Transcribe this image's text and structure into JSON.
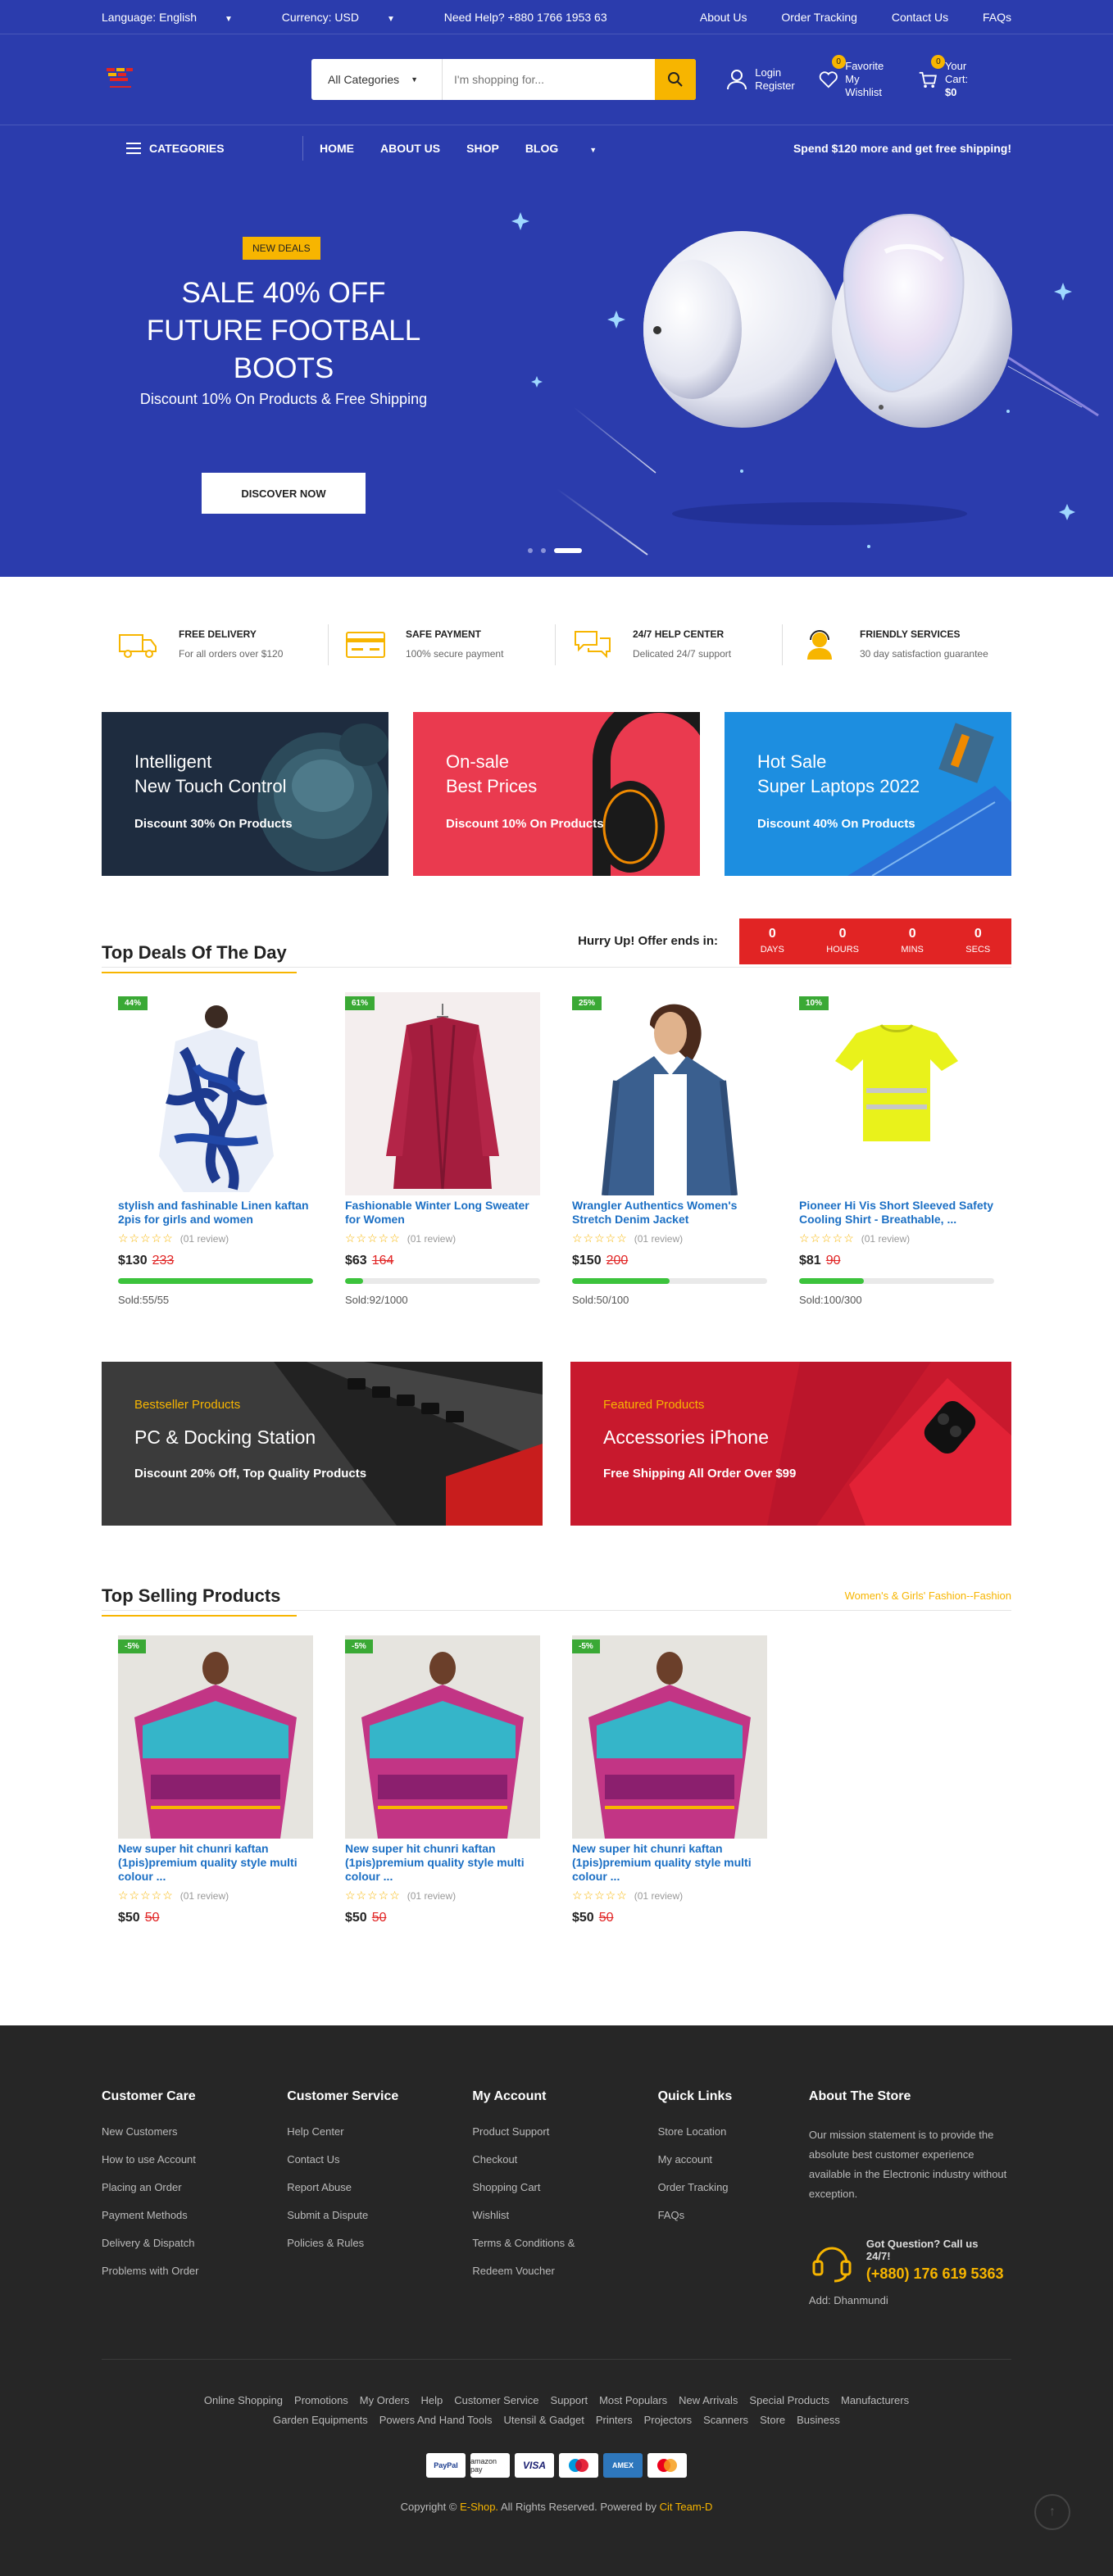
{
  "topbar": {
    "language": "Language: English",
    "currency": "Currency: USD",
    "help": "Need Help? +880 1766 1953 63",
    "links": [
      "About Us",
      "Order Tracking",
      "Contact Us",
      "FAQs"
    ]
  },
  "header": {
    "search_category": "All Categories",
    "search_placeholder": "I'm shopping for...",
    "login": "Login",
    "register": "Register",
    "favorite": "Favorite",
    "wishlist": "My Wishlist",
    "wishlist_count": "0",
    "cart_label": "Your Cart:",
    "cart_total": "$0",
    "cart_count": "0"
  },
  "nav": {
    "categories": "CATEGORIES",
    "links": [
      "HOME",
      "ABOUT US",
      "SHOP",
      "BLOG"
    ],
    "promo": "Spend $120 more and get free shipping!"
  },
  "hero": {
    "tag": "NEW DEALS",
    "title_1": "SALE 40% OFF",
    "title_2": "FUTURE FOOTBALL",
    "title_3": "BOOTS",
    "subtitle": "Discount 10% On Products & Free Shipping",
    "cta": "DISCOVER NOW"
  },
  "features": [
    {
      "title": "FREE DELIVERY",
      "sub": "For all orders over $120"
    },
    {
      "title": "SAFE PAYMENT",
      "sub": "100% secure payment"
    },
    {
      "title": "24/7 HELP CENTER",
      "sub": "Delicated 24/7 support"
    },
    {
      "title": "FRIENDLY SERVICES",
      "sub": "30 day satisfaction guarantee"
    }
  ],
  "banners": [
    {
      "line1": "Intelligent",
      "line2": "New Touch Control",
      "sub": "Discount 30% On Products"
    },
    {
      "line1": "On-sale",
      "line2": "Best Prices",
      "sub": "Discount 10% On Products"
    },
    {
      "line1": "Hot Sale",
      "line2": "Super Laptops 2022",
      "sub": "Discount 40% On Products"
    }
  ],
  "deals": {
    "title": "Top Deals Of The Day",
    "hurry": "Hurry Up! Offer ends in:",
    "countdown": [
      {
        "value": "0",
        "unit": "DAYS"
      },
      {
        "value": "0",
        "unit": "HOURS"
      },
      {
        "value": "0",
        "unit": "MINS"
      },
      {
        "value": "0",
        "unit": "SECS"
      }
    ],
    "products": [
      {
        "discount": "44%",
        "name": "stylish and fashinable Linen kaftan 2pis for girls and women",
        "reviews": "(01 review)",
        "price": "$130",
        "old": "233",
        "sold": "Sold:55/55",
        "progress": 1.0
      },
      {
        "discount": "61%",
        "name": "Fashionable Winter Long Sweater for Women",
        "reviews": "(01 review)",
        "price": "$63",
        "old": "164",
        "sold": "Sold:92/1000",
        "progress": 0.092
      },
      {
        "discount": "25%",
        "name": "Wrangler Authentics Women's Stretch Denim Jacket",
        "reviews": "(01 review)",
        "price": "$150",
        "old": "200",
        "sold": "Sold:50/100",
        "progress": 0.5
      },
      {
        "discount": "10%",
        "name": "Pioneer Hi Vis Short Sleeved Safety Cooling Shirt - Breathable, ...",
        "reviews": "(01 review)",
        "price": "$81",
        "old": "90",
        "sold": "Sold:100/300",
        "progress": 0.333
      }
    ]
  },
  "wide_banners": [
    {
      "kicker": "Bestseller Products",
      "title": "PC & Docking Station",
      "sub": "Discount 20% Off, Top Quality Products"
    },
    {
      "kicker": "Featured Products",
      "title": "Accessories iPhone",
      "sub": "Free Shipping All Order Over $99"
    }
  ],
  "top_selling": {
    "title": "Top Selling Products",
    "filter": "Women's & Girls' Fashion--Fashion",
    "products": [
      {
        "discount": "-5%",
        "name": "New super hit chunri kaftan (1pis)premium quality style multi colour ...",
        "reviews": "(01 review)",
        "price": "$50",
        "old": "50"
      },
      {
        "discount": "-5%",
        "name": "New super hit chunri kaftan (1pis)premium quality style multi colour ...",
        "reviews": "(01 review)",
        "price": "$50",
        "old": "50"
      },
      {
        "discount": "-5%",
        "name": "New super hit chunri kaftan (1pis)premium quality style multi colour ...",
        "reviews": "(01 review)",
        "price": "$50",
        "old": "50"
      }
    ]
  },
  "footer": {
    "columns": [
      {
        "title": "Customer Care",
        "links": [
          "New Customers",
          "How to use Account",
          "Placing an Order",
          "Payment Methods",
          "Delivery & Dispatch",
          "Problems with Order"
        ]
      },
      {
        "title": "Customer Service",
        "links": [
          "Help Center",
          "Contact Us",
          "Report Abuse",
          "Submit a Dispute",
          "Policies & Rules"
        ]
      },
      {
        "title": "My Account",
        "links": [
          "Product Support",
          "Checkout",
          "Shopping Cart",
          "Wishlist",
          "Terms & Conditions &",
          "Redeem Voucher"
        ]
      },
      {
        "title": "Quick Links",
        "links": [
          "Store Location",
          "My account",
          "Order Tracking",
          "FAQs"
        ]
      }
    ],
    "about_title": "About The Store",
    "about_text": "Our mission statement is to provide the absolute best customer experience available in the Electronic industry without exception.",
    "question": "Got Question? Call us 24/7!",
    "phone": "(+880) 176 619 5363",
    "address": "Add: Dhanmundi",
    "tags": [
      "Online Shopping",
      "Promotions",
      "My Orders",
      "Help",
      "Customer Service",
      "Support",
      "Most Populars",
      "New Arrivals",
      "Special Products",
      "Manufacturers",
      "Garden Equipments",
      "Powers And Hand Tools",
      "Utensil & Gadget",
      "Printers",
      "Projectors",
      "Scanners",
      "Store",
      "Business"
    ],
    "payments": [
      "PayPal",
      "amazon pay",
      "VISA",
      "Maestro",
      "AMEX",
      "Mastercard"
    ],
    "copyright_pre": "Copyright ©",
    "copyright_brand": "E-Shop.",
    "copyright_mid": "All Rights Reserved. Powered by",
    "copyright_team": "Cit Team-D"
  },
  "colors": {
    "brand": "#2b3cad",
    "accent": "#f7b500",
    "sale": "#e12424",
    "progress": "#3cc33c"
  }
}
